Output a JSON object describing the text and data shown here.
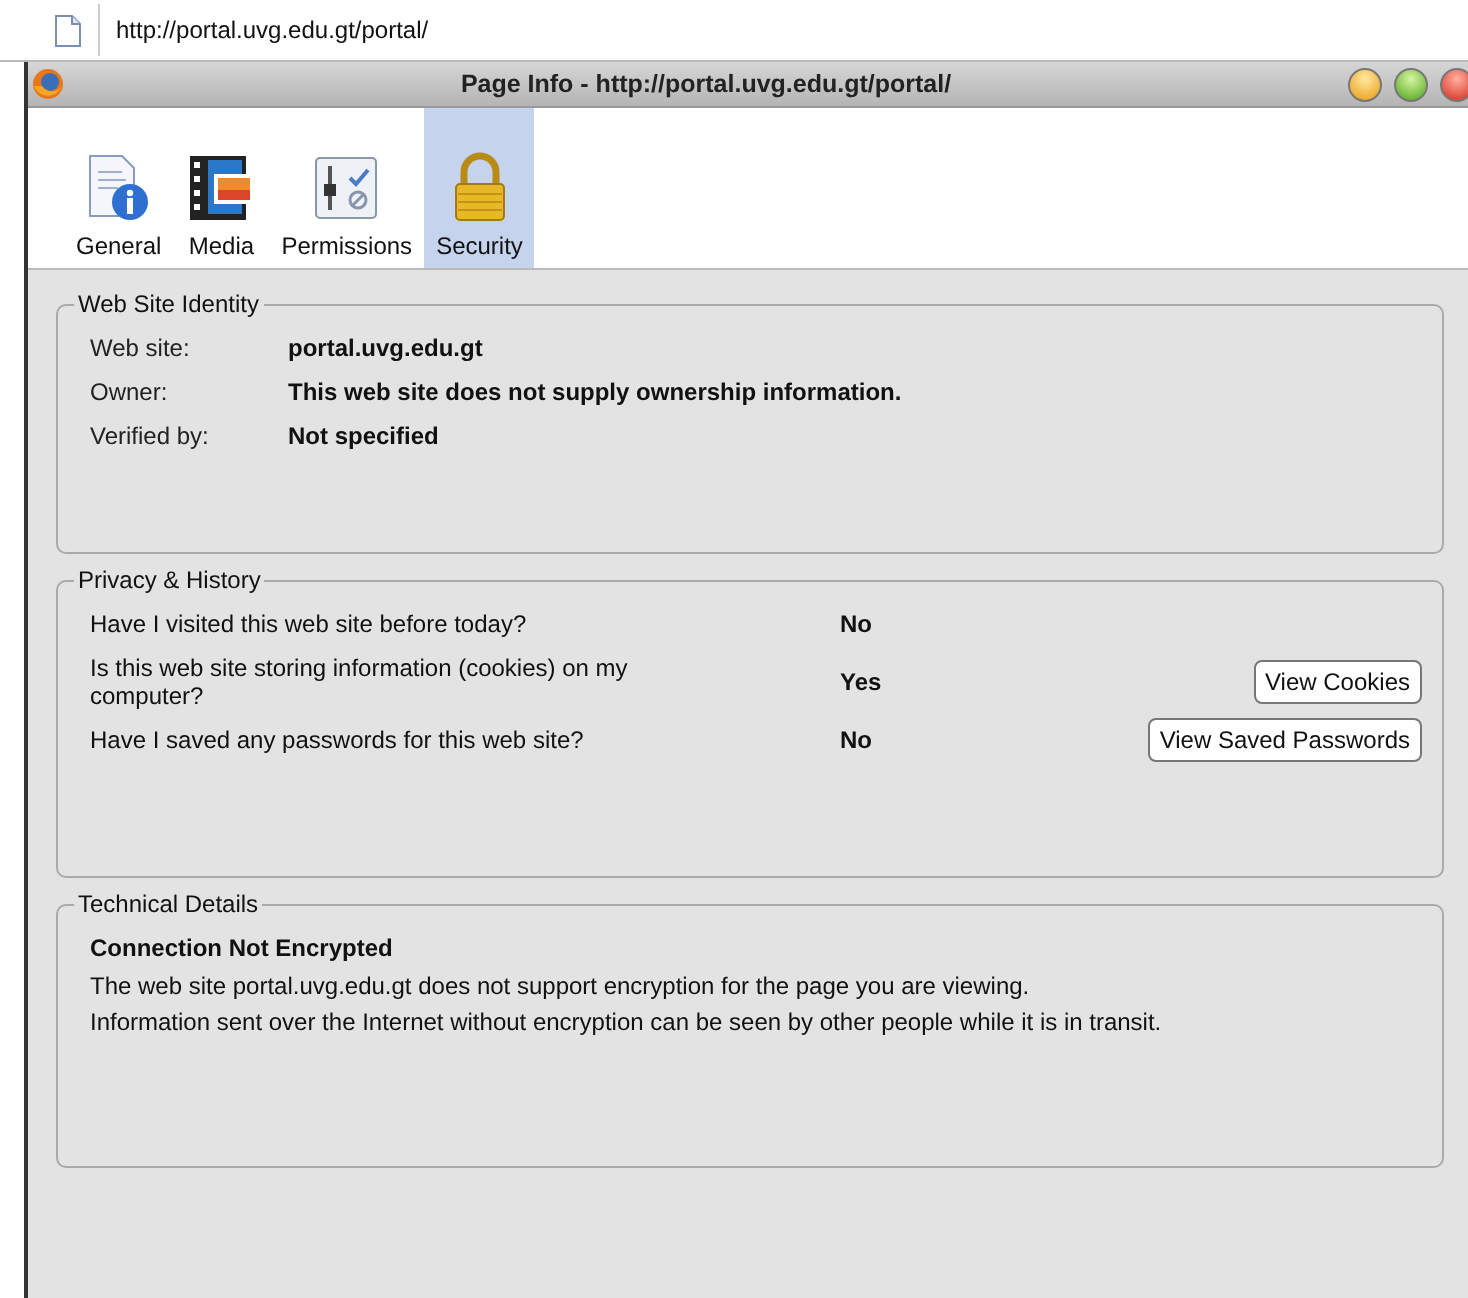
{
  "address_bar": {
    "url": "http://portal.uvg.edu.gt/portal/"
  },
  "window": {
    "title": "Page Info - http://portal.uvg.edu.gt/portal/"
  },
  "tabs": [
    {
      "label": "General",
      "kind": "general",
      "selected": false
    },
    {
      "label": "Media",
      "kind": "media",
      "selected": false
    },
    {
      "label": "Permissions",
      "kind": "permissions",
      "selected": false
    },
    {
      "label": "Security",
      "kind": "security",
      "selected": true
    }
  ],
  "identity": {
    "title": "Web Site Identity",
    "rows": [
      {
        "label": "Web site:",
        "value": "portal.uvg.edu.gt"
      },
      {
        "label": "Owner:",
        "value": "This web site does not supply ownership information."
      },
      {
        "label": "Verified by:",
        "value": "Not specified"
      }
    ]
  },
  "privacy": {
    "title": "Privacy & History",
    "rows": [
      {
        "question": "Have I visited this web site before today?",
        "answer": "No"
      },
      {
        "question": "Is this web site storing information (cookies) on my computer?",
        "answer": "Yes",
        "button": {
          "label": "View Cookies"
        }
      },
      {
        "question": "Have I saved any passwords for this web site?",
        "answer": "No",
        "button": {
          "label": "View Saved Passwords"
        }
      }
    ]
  },
  "technical": {
    "title": "Technical Details",
    "heading": "Connection Not Encrypted",
    "lines": [
      "The web site portal.uvg.edu.gt does not support encryption for the page you are viewing.",
      "Information sent over the Internet without encryption can be seen by other people while it is in transit."
    ]
  }
}
